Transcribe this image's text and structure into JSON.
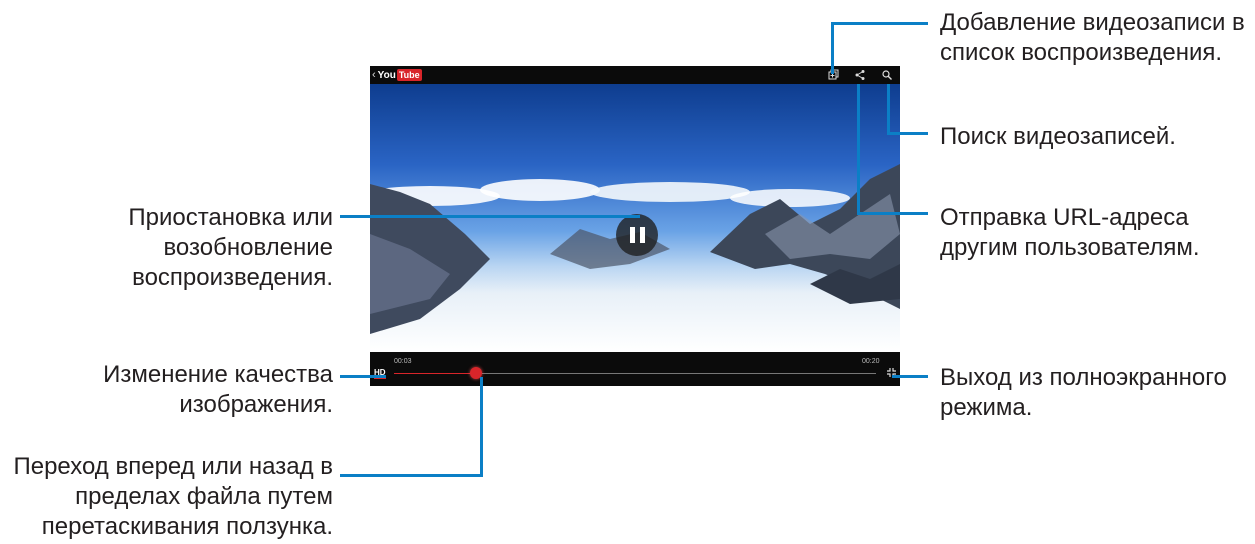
{
  "callouts": {
    "pause": "Приостановка или\nвозобновление\nвоспроизведения.",
    "quality": "Изменение качества\nизображения.",
    "seek": "Переход вперед или назад в\nпределах файла путем\nперетаскивания ползунка.",
    "playlist": "Добавление видеозаписи в\nсписок воспроизведения.",
    "search": "Поиск видеозаписей.",
    "share": "Отправка URL-адреса\nдругим пользователям.",
    "exit_fullscreen": "Выход из полноэкранного\nрежима."
  },
  "player": {
    "logo_back": "‹",
    "logo_you": "You",
    "logo_tube": "Tube",
    "hd_label": "HD",
    "time_elapsed": "00:03",
    "time_total": "00:20",
    "progress": 0.17,
    "icons": [
      "playlist-add-icon",
      "share-icon",
      "search-icon",
      "pause-icon",
      "exit-fullscreen-icon"
    ]
  },
  "colors": {
    "leader": "#0b7fc6",
    "accent": "#d9252a",
    "bar": "#0b0b0b"
  }
}
